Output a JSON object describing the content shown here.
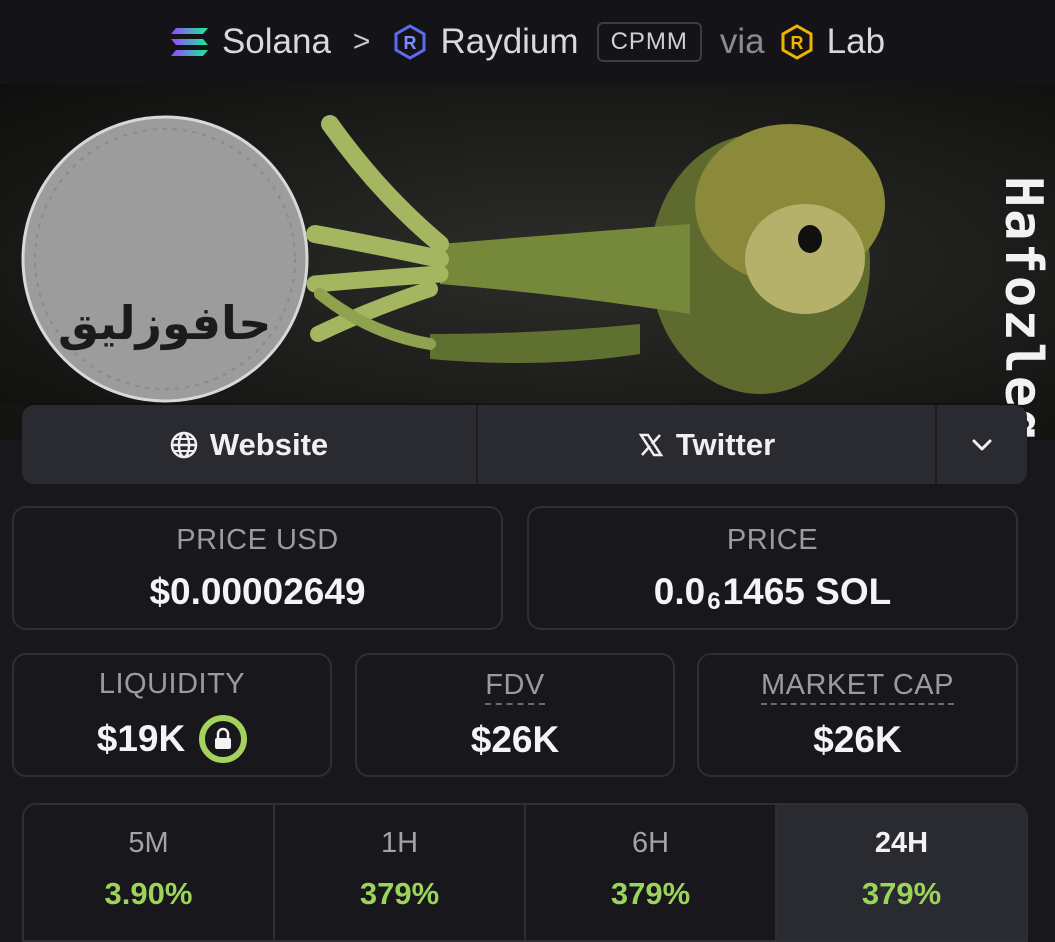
{
  "breadcrumb": {
    "chain": "Solana",
    "separator": ">",
    "dex": "Raydium",
    "pool_type": "CPMM",
    "via_label": "via",
    "launchpad": "Lab"
  },
  "banner": {
    "arabic_text": "حافوزليق",
    "vertical_name": "Hafozleq"
  },
  "links": {
    "website_label": "Website",
    "twitter_label": "Twitter"
  },
  "stats": {
    "price_usd": {
      "label": "PRICE USD",
      "value": "$0.00002649"
    },
    "price": {
      "label": "PRICE",
      "value_prefix": "0.0",
      "value_subscript": "6",
      "value_suffix": "1465 SOL"
    },
    "liquidity": {
      "label": "LIQUIDITY",
      "value": "$19K"
    },
    "fdv": {
      "label": "FDV",
      "value": "$26K"
    },
    "market_cap": {
      "label": "MARKET CAP",
      "value": "$26K"
    }
  },
  "timeframes": [
    {
      "label": "5M",
      "value": "3.90%",
      "active": false
    },
    {
      "label": "1H",
      "value": "379%",
      "active": false
    },
    {
      "label": "6H",
      "value": "379%",
      "active": false
    },
    {
      "label": "24H",
      "value": "379%",
      "active": true
    }
  ],
  "colors": {
    "positive": "#9cd35a",
    "background": "#17171c",
    "card_border": "#2e2e36",
    "solana_gradient": [
      "#9945ff",
      "#14f195"
    ],
    "raydium_blue": "#5a6cf0",
    "lab_yellow": "#f0b400"
  },
  "icons": {
    "chain": "solana-icon",
    "dex": "raydium-icon",
    "launchpad": "lab-icon",
    "website": "globe-icon",
    "twitter": "x-icon",
    "more": "chevron-down-icon",
    "liquidity_lock": "lock-icon"
  }
}
